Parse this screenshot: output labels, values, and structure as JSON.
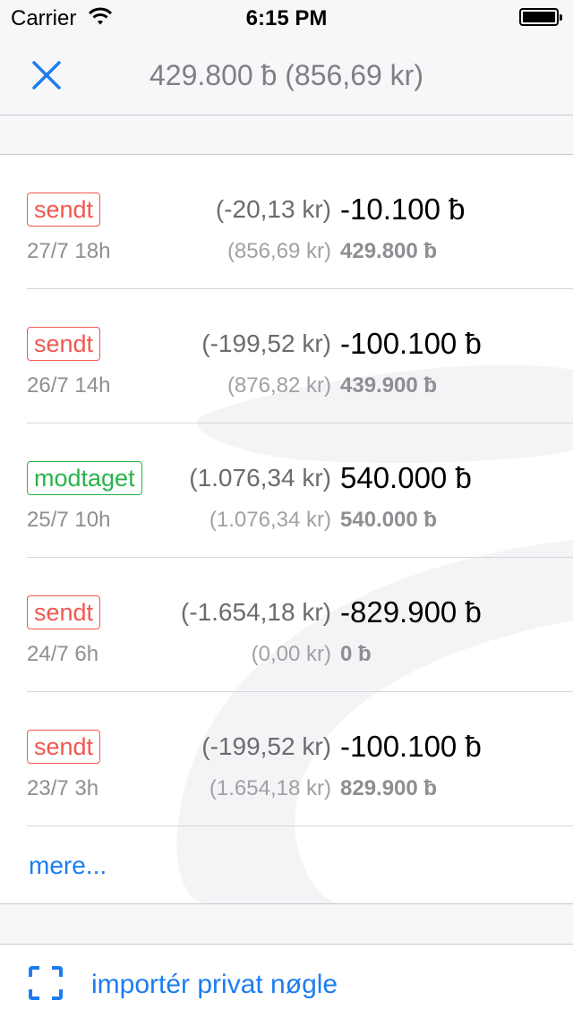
{
  "status_bar": {
    "carrier": "Carrier",
    "time": "6:15 PM",
    "battery_level": 1.0
  },
  "nav": {
    "title": "429.800 ƀ (856,69 kr)",
    "close_icon": "close-icon"
  },
  "transactions": [
    {
      "status": "sendt",
      "type": "sent",
      "date": "27/7 18h",
      "fiat": "(-20,13 kr)",
      "amount": "-10.100 ƀ",
      "balance_fiat": "(856,69 kr)",
      "balance": "429.800 ƀ"
    },
    {
      "status": "sendt",
      "type": "sent",
      "date": "26/7 14h",
      "fiat": "(-199,52 kr)",
      "amount": "-100.100 ƀ",
      "balance_fiat": "(876,82 kr)",
      "balance": "439.900 ƀ"
    },
    {
      "status": "modtaget",
      "type": "received",
      "date": "25/7 10h",
      "fiat": "(1.076,34 kr)",
      "amount": "540.000 ƀ",
      "balance_fiat": "(1.076,34 kr)",
      "balance": "540.000 ƀ"
    },
    {
      "status": "sendt",
      "type": "sent",
      "date": "24/7 6h",
      "fiat": "(-1.654,18 kr)",
      "amount": "-829.900 ƀ",
      "balance_fiat": "(0,00 kr)",
      "balance": "0 ƀ"
    },
    {
      "status": "sendt",
      "type": "sent",
      "date": "23/7 3h",
      "fiat": "(-199,52 kr)",
      "amount": "-100.100 ƀ",
      "balance_fiat": "(1.654,18 kr)",
      "balance": "829.900 ƀ"
    }
  ],
  "more_label": "mere...",
  "import": {
    "label": "importér privat nøgle",
    "icon": "scan-icon"
  },
  "colors": {
    "accent": "#1c7df0",
    "sent": "#f2574f",
    "received": "#29b34a"
  }
}
